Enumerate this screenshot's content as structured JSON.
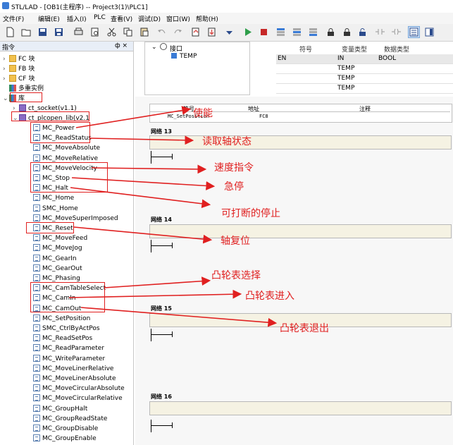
{
  "window": {
    "title": "STL/LAD - [OB1(主程序) -- Project3(1)\\PLC1]"
  },
  "menu": [
    "文件(F)",
    "编辑(E)",
    "插入(I)",
    "PLC",
    "查看(V)",
    "调试(D)",
    "窗口(W)",
    "帮助(H)"
  ],
  "left_panel": {
    "title": "指令",
    "pin": "ф ×",
    "tree": {
      "fc": "FC 块",
      "fb": "FB 块",
      "cf": "CF 块",
      "multi": "多重实例",
      "lib": "库",
      "socket": "ct_socket(v1.1)",
      "plcopen": "ct_plcopen_lib(v2.1"
    },
    "items": [
      "MC_Power",
      "MC_ReadStatus",
      "MC_MoveAbsolute",
      "MC_MoveRelative",
      "MC_MoveVelocity",
      "MC_Stop",
      "MC_Halt",
      "MC_Home",
      "SMC_Home",
      "MC_MoveSuperImposed",
      "MC_Reset",
      "MC_MoveFeed",
      "MC_MoveJog",
      "MC_GearIn",
      "MC_GearOut",
      "MC_Phasing",
      "MC_CamTableSelect",
      "MC_CamIn",
      "MC_CamOut",
      "MC_SetPosition",
      "SMC_CtrlByActPos",
      "MC_ReadSetPos",
      "MC_ReadParameter",
      "MC_WriteParameter",
      "MC_MoveLinerRelative",
      "MC_MoveLinerAbsolute",
      "MC_MoveCircularAbsolute",
      "MC_MoveCircularRelative",
      "MC_GroupHalt",
      "MC_GroupReadState",
      "MC_GroupDisable",
      "MC_GroupEnable"
    ]
  },
  "interface": {
    "root": "接口",
    "child": "TEMP"
  },
  "interface_table": {
    "headers": [
      "符号",
      "变量类型",
      "数据类型"
    ],
    "rows": [
      {
        "symbol": "EN",
        "var_type": "IN",
        "data_type": "BOOL"
      },
      {
        "symbol": "",
        "var_type": "TEMP",
        "data_type": ""
      },
      {
        "symbol": "",
        "var_type": "TEMP",
        "data_type": ""
      },
      {
        "symbol": "",
        "var_type": "TEMP",
        "data_type": ""
      }
    ]
  },
  "symbol_table": {
    "headers": [
      "符号",
      "地址",
      "注释"
    ],
    "row": {
      "symbol": "MC_SetPosition",
      "address": "FC8",
      "comment": ""
    }
  },
  "networks": [
    "网络 13",
    "网络 14",
    "网络 15",
    "网络 16"
  ],
  "annotations": {
    "enable": "使能",
    "read_status": "读取轴状态",
    "velocity": "速度指令",
    "stop": "急停",
    "halt": "可打断的停止",
    "reset": "轴复位",
    "cam_select": "凸轮表选择",
    "cam_in": "凸轮表进入",
    "cam_out": "凸轮表退出"
  },
  "colors": {
    "annotation": "#e02020",
    "net_box": "#f5f2e3"
  }
}
